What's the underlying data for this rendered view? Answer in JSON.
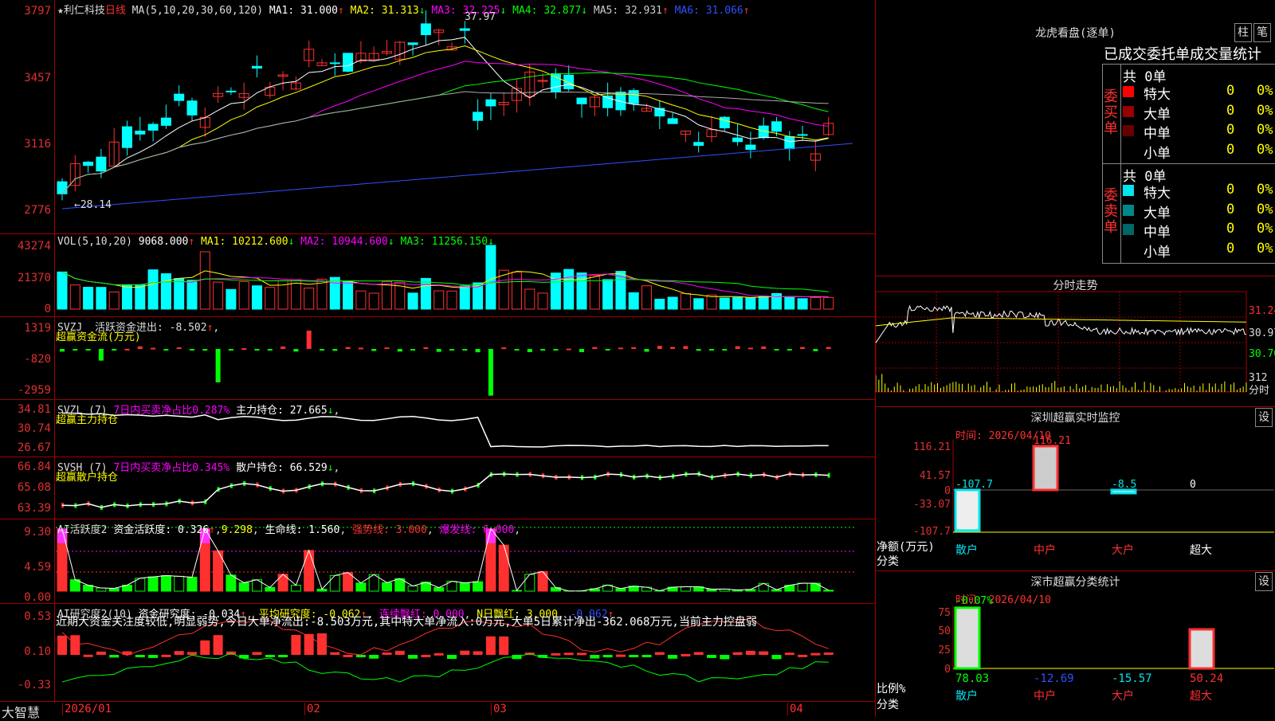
{
  "price": {
    "stock_name": "★利仁科技",
    "period": "日线",
    "ma_label": "MA(5,10,20,30,60,120)",
    "ma_items": [
      {
        "text": "MA1: 31.000",
        "arrow": "↑",
        "color": "#ffffff"
      },
      {
        "text": "MA2: 31.313",
        "arrow": "↓",
        "color": "#ffff00"
      },
      {
        "text": "MA3: 32.225",
        "arrow": "↓",
        "color": "#ff00ff"
      },
      {
        "text": "MA4: 32.877",
        "arrow": "↓",
        "color": "#00ff00"
      },
      {
        "text": "MA5: 32.931",
        "arrow": "↑",
        "color": "#cccccc"
      },
      {
        "text": "MA6: 31.066",
        "arrow": "↑",
        "color": "#3050ff"
      }
    ],
    "y_ticks": [
      "3797",
      "3457",
      "3116",
      "2776"
    ],
    "high_label": "37.97",
    "low_label": "←28.14"
  },
  "vol": {
    "label": "VOL(5,10,20)",
    "value": "9068.000",
    "items": [
      {
        "text": "MA1: 10212.600",
        "arrow": "↓",
        "color": "#ffff00"
      },
      {
        "text": "MA2: 10944.600",
        "arrow": "↓",
        "color": "#ff00ff"
      },
      {
        "text": "MA3: 11256.150",
        "arrow": "↓",
        "color": "#00ff00"
      }
    ],
    "y_ticks": [
      "43274",
      "21370",
      "0"
    ]
  },
  "svzj": {
    "label": "SVZJ",
    "item": "活跃资金进出: -8.502",
    "arrow": "↑",
    "sub": "超赢资金流(万元)",
    "y_ticks": [
      "1319",
      "-820",
      "-2959"
    ]
  },
  "svzl": {
    "label": "SVZL (7)",
    "item1": "7日内买卖净占比0.287%",
    "item2": "主力持仓: 27.665",
    "arrow": "↓",
    "sub": "超赢主力持仓",
    "y_ticks": [
      "34.81",
      "30.74",
      "26.67"
    ]
  },
  "svsh": {
    "label": "SVSH (7)",
    "item1": "7日内买卖净占比0.345%",
    "item2": "散户持仓: 66.529",
    "arrow": "↓",
    "sub": "超赢散户持仓",
    "y_ticks": [
      "66.84",
      "65.08",
      "63.39"
    ]
  },
  "ai1": {
    "label": "AI活跃度2",
    "item1": "资金活跃度: 0.326",
    "arrow1": "↑",
    "item2": "9.298",
    "item3": "生命线: 1.560",
    "item4": "强势线: 3.000",
    "item5": "爆发线: 6.000",
    "y_ticks": [
      "9.30",
      "4.59",
      "0.00"
    ]
  },
  "ai2": {
    "label": "AI研究度2(10)",
    "item1": "资金研究度: -0.034",
    "arrow1": "↑",
    "item2": "平均研究度: -0.062",
    "arrow2": "↑",
    "item3": "连续飘红: 0.000",
    "item4": "N日飘红: 3.000",
    "item5": "-0.062",
    "arrow5": "↑",
    "comment": "近期大资金关注度较低,明显弱势,今日大单净流出:-8.503万元,其中特大单净流入:0万元,大单5日累计净出-362.068万元,当前主力控盘弱",
    "y_ticks": [
      "0.53",
      "0.10",
      "-0.33"
    ]
  },
  "xaxis": {
    "brand": "大智慧",
    "dates": [
      "2026/01",
      "02",
      "03",
      "04"
    ]
  },
  "lhb": {
    "title": "龙虎看盘(逐单)",
    "btn1": "柱",
    "btn2": "笔",
    "table_title": "已成交委托单成交量统计",
    "buy_label": "委买单",
    "sell_label": "委卖单",
    "buy_total": "共 0单",
    "sell_total": "共 0单",
    "buy_rows": [
      {
        "name": "特大",
        "v": "0",
        "p": "0%",
        "color": "#ff0000"
      },
      {
        "name": "大单",
        "v": "0",
        "p": "0%",
        "color": "#990000"
      },
      {
        "name": "中单",
        "v": "0",
        "p": "0%",
        "color": "#660000"
      },
      {
        "name": "小单",
        "v": "0",
        "p": "0%",
        "color": ""
      }
    ],
    "sell_rows": [
      {
        "name": "特大",
        "v": "0",
        "p": "0%",
        "color": "#00e5ee"
      },
      {
        "name": "大单",
        "v": "0",
        "p": "0%",
        "color": "#008888"
      },
      {
        "name": "中单",
        "v": "0",
        "p": "0%",
        "color": "#006666"
      },
      {
        "name": "小单",
        "v": "0",
        "p": "0%",
        "color": ""
      }
    ]
  },
  "intraday": {
    "title": "分时走势",
    "y_ticks": [
      "31.24",
      "30.97",
      "30.70"
    ],
    "vol_ticks": [
      "312",
      "分时"
    ]
  },
  "sz_monitor": {
    "title": "深圳超赢实时监控",
    "btn": "设",
    "time": "时间: 2026/04/10",
    "y_ticks": [
      "116.21",
      "41.57",
      "0",
      "-33.07",
      "-107.7"
    ],
    "bars": [
      {
        "name": "散户",
        "value": "-107.7"
      },
      {
        "name": "中户",
        "value": "116.21"
      },
      {
        "name": "大户",
        "value": "-8.5"
      },
      {
        "name": "超大",
        "value": "0"
      }
    ],
    "net_label": "净额(万元)",
    "cat_label": "分类"
  },
  "sz_class": {
    "title": "深市超赢分类统计",
    "btn": "设",
    "time": "时间: 2026/04/10",
    "top_value": "-0.07%",
    "y_ticks": [
      "75",
      "50",
      "25",
      "0"
    ],
    "values": [
      "78.03",
      "-12.69",
      "-15.57",
      "50.24"
    ],
    "cats": [
      "散户",
      "中户",
      "大户",
      "超大"
    ],
    "ratio_label": "比例%",
    "cat_label": "分类"
  }
}
